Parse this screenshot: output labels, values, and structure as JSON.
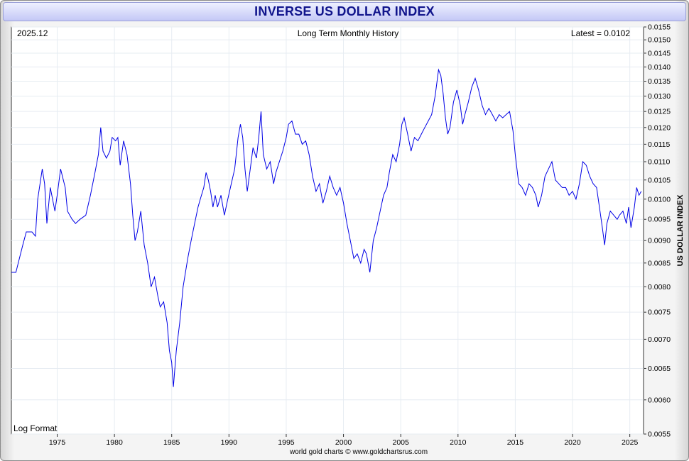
{
  "title": "INVERSE US DOLLAR INDEX",
  "footer": "world gold charts © www.goldchartsrus.com",
  "chart_data": {
    "type": "line",
    "title": "INVERSE US DOLLAR INDEX",
    "subtitle": "Long Term Monthly History",
    "date_label": "2025.12",
    "latest_label": "Latest = 0.0102",
    "scale_note": "Log Format",
    "ylabel": "US DOLLAR INDEX",
    "xlabel": "",
    "y_scale": "log",
    "ylim": [
      0.0055,
      0.0155
    ],
    "xlim": [
      1971.0,
      2026.2
    ],
    "grid": true,
    "line_color": "#0000e6",
    "xticks": [
      1975,
      1980,
      1985,
      1990,
      1995,
      2000,
      2005,
      2010,
      2015,
      2020,
      2025
    ],
    "yticks": [
      "0.0055",
      "0.0060",
      "0.0065",
      "0.0070",
      "0.0075",
      "0.0080",
      "0.0085",
      "0.0090",
      "0.0095",
      "0.0100",
      "0.0105",
      "0.0110",
      "0.0115",
      "0.0120",
      "0.0125",
      "0.0130",
      "0.0135",
      "0.0140",
      "0.0145",
      "0.0150",
      "0.0155"
    ],
    "series": [
      {
        "points": [
          [
            1971.0,
            0.0083
          ],
          [
            1971.4,
            0.0083
          ],
          [
            1971.7,
            0.0086
          ],
          [
            1972.0,
            0.0089
          ],
          [
            1972.3,
            0.0092
          ],
          [
            1972.8,
            0.0092
          ],
          [
            1973.1,
            0.0091
          ],
          [
            1973.3,
            0.01
          ],
          [
            1973.7,
            0.0108
          ],
          [
            1973.9,
            0.0104
          ],
          [
            1974.1,
            0.0094
          ],
          [
            1974.4,
            0.0103
          ],
          [
            1974.8,
            0.0097
          ],
          [
            1975.0,
            0.0101
          ],
          [
            1975.3,
            0.0108
          ],
          [
            1975.7,
            0.0103
          ],
          [
            1975.9,
            0.0097
          ],
          [
            1976.3,
            0.0095
          ],
          [
            1976.6,
            0.0094
          ],
          [
            1977.0,
            0.0095
          ],
          [
            1977.5,
            0.0096
          ],
          [
            1977.9,
            0.0101
          ],
          [
            1978.3,
            0.0107
          ],
          [
            1978.6,
            0.0112
          ],
          [
            1978.8,
            0.012
          ],
          [
            1979.0,
            0.0113
          ],
          [
            1979.3,
            0.0111
          ],
          [
            1979.6,
            0.0113
          ],
          [
            1979.8,
            0.0117
          ],
          [
            1980.1,
            0.0116
          ],
          [
            1980.3,
            0.0117
          ],
          [
            1980.5,
            0.0109
          ],
          [
            1980.8,
            0.0116
          ],
          [
            1981.1,
            0.0112
          ],
          [
            1981.4,
            0.0104
          ],
          [
            1981.6,
            0.0096
          ],
          [
            1981.8,
            0.009
          ],
          [
            1982.0,
            0.0092
          ],
          [
            1982.3,
            0.0097
          ],
          [
            1982.6,
            0.0089
          ],
          [
            1982.9,
            0.0085
          ],
          [
            1983.2,
            0.008
          ],
          [
            1983.5,
            0.0082
          ],
          [
            1983.8,
            0.0078
          ],
          [
            1984.0,
            0.0076
          ],
          [
            1984.3,
            0.0077
          ],
          [
            1984.6,
            0.0073
          ],
          [
            1984.8,
            0.0068
          ],
          [
            1985.0,
            0.0066
          ],
          [
            1985.15,
            0.0062
          ],
          [
            1985.4,
            0.0068
          ],
          [
            1985.7,
            0.0073
          ],
          [
            1986.0,
            0.008
          ],
          [
            1986.4,
            0.0086
          ],
          [
            1986.7,
            0.009
          ],
          [
            1987.0,
            0.0094
          ],
          [
            1987.3,
            0.0098
          ],
          [
            1987.5,
            0.01
          ],
          [
            1987.8,
            0.0103
          ],
          [
            1988.0,
            0.0107
          ],
          [
            1988.2,
            0.0105
          ],
          [
            1988.4,
            0.0102
          ],
          [
            1988.6,
            0.0098
          ],
          [
            1988.8,
            0.0101
          ],
          [
            1989.0,
            0.0098
          ],
          [
            1989.3,
            0.0101
          ],
          [
            1989.6,
            0.0096
          ],
          [
            1989.9,
            0.01
          ],
          [
            1990.2,
            0.0104
          ],
          [
            1990.5,
            0.0108
          ],
          [
            1990.8,
            0.0117
          ],
          [
            1991.0,
            0.0121
          ],
          [
            1991.2,
            0.0117
          ],
          [
            1991.4,
            0.0108
          ],
          [
            1991.6,
            0.0102
          ],
          [
            1991.9,
            0.0109
          ],
          [
            1992.1,
            0.0114
          ],
          [
            1992.4,
            0.0111
          ],
          [
            1992.6,
            0.0117
          ],
          [
            1992.8,
            0.0125
          ],
          [
            1993.0,
            0.0112
          ],
          [
            1993.3,
            0.0108
          ],
          [
            1993.6,
            0.011
          ],
          [
            1993.9,
            0.0104
          ],
          [
            1994.1,
            0.0107
          ],
          [
            1994.4,
            0.011
          ],
          [
            1994.7,
            0.0113
          ],
          [
            1995.0,
            0.0117
          ],
          [
            1995.2,
            0.0121
          ],
          [
            1995.5,
            0.0122
          ],
          [
            1995.8,
            0.0118
          ],
          [
            1996.1,
            0.0118
          ],
          [
            1996.4,
            0.0115
          ],
          [
            1996.7,
            0.0116
          ],
          [
            1997.0,
            0.0112
          ],
          [
            1997.3,
            0.0106
          ],
          [
            1997.6,
            0.0102
          ],
          [
            1997.9,
            0.0104
          ],
          [
            1998.2,
            0.0099
          ],
          [
            1998.5,
            0.0102
          ],
          [
            1998.8,
            0.0106
          ],
          [
            1999.1,
            0.0103
          ],
          [
            1999.4,
            0.0101
          ],
          [
            1999.7,
            0.0103
          ],
          [
            2000.0,
            0.0099
          ],
          [
            2000.3,
            0.0094
          ],
          [
            2000.6,
            0.009
          ],
          [
            2000.9,
            0.0086
          ],
          [
            2001.2,
            0.0087
          ],
          [
            2001.5,
            0.0085
          ],
          [
            2001.8,
            0.0088
          ],
          [
            2002.0,
            0.0087
          ],
          [
            2002.3,
            0.0083
          ],
          [
            2002.6,
            0.009
          ],
          [
            2002.9,
            0.0093
          ],
          [
            2003.2,
            0.0097
          ],
          [
            2003.5,
            0.0101
          ],
          [
            2003.8,
            0.0103
          ],
          [
            2004.0,
            0.0107
          ],
          [
            2004.3,
            0.0112
          ],
          [
            2004.6,
            0.011
          ],
          [
            2004.9,
            0.0115
          ],
          [
            2005.1,
            0.0121
          ],
          [
            2005.3,
            0.0123
          ],
          [
            2005.6,
            0.0118
          ],
          [
            2005.9,
            0.0113
          ],
          [
            2006.2,
            0.0117
          ],
          [
            2006.5,
            0.0116
          ],
          [
            2006.8,
            0.0118
          ],
          [
            2007.1,
            0.012
          ],
          [
            2007.4,
            0.0122
          ],
          [
            2007.7,
            0.0124
          ],
          [
            2008.0,
            0.013
          ],
          [
            2008.3,
            0.0139
          ],
          [
            2008.5,
            0.0137
          ],
          [
            2008.7,
            0.0131
          ],
          [
            2008.9,
            0.0123
          ],
          [
            2009.1,
            0.0118
          ],
          [
            2009.3,
            0.012
          ],
          [
            2009.6,
            0.0128
          ],
          [
            2009.9,
            0.0132
          ],
          [
            2010.2,
            0.0127
          ],
          [
            2010.4,
            0.0121
          ],
          [
            2010.6,
            0.0124
          ],
          [
            2010.9,
            0.0128
          ],
          [
            2011.2,
            0.0133
          ],
          [
            2011.5,
            0.0136
          ],
          [
            2011.8,
            0.0132
          ],
          [
            2012.1,
            0.0127
          ],
          [
            2012.4,
            0.0124
          ],
          [
            2012.7,
            0.0126
          ],
          [
            2013.0,
            0.0124
          ],
          [
            2013.3,
            0.0122
          ],
          [
            2013.6,
            0.0124
          ],
          [
            2013.9,
            0.0123
          ],
          [
            2014.2,
            0.0124
          ],
          [
            2014.5,
            0.0125
          ],
          [
            2014.8,
            0.0119
          ],
          [
            2015.0,
            0.0112
          ],
          [
            2015.3,
            0.0104
          ],
          [
            2015.6,
            0.0103
          ],
          [
            2015.9,
            0.0101
          ],
          [
            2016.2,
            0.0104
          ],
          [
            2016.5,
            0.0103
          ],
          [
            2016.8,
            0.0101
          ],
          [
            2017.0,
            0.0098
          ],
          [
            2017.3,
            0.0101
          ],
          [
            2017.6,
            0.0106
          ],
          [
            2017.9,
            0.0108
          ],
          [
            2018.2,
            0.011
          ],
          [
            2018.5,
            0.0105
          ],
          [
            2018.8,
            0.0104
          ],
          [
            2019.1,
            0.0103
          ],
          [
            2019.4,
            0.0103
          ],
          [
            2019.7,
            0.0101
          ],
          [
            2020.0,
            0.0102
          ],
          [
            2020.3,
            0.01
          ],
          [
            2020.6,
            0.0104
          ],
          [
            2020.9,
            0.011
          ],
          [
            2021.2,
            0.0109
          ],
          [
            2021.5,
            0.0106
          ],
          [
            2021.8,
            0.0104
          ],
          [
            2022.1,
            0.0103
          ],
          [
            2022.4,
            0.0097
          ],
          [
            2022.6,
            0.0093
          ],
          [
            2022.8,
            0.0089
          ],
          [
            2023.0,
            0.0094
          ],
          [
            2023.3,
            0.0097
          ],
          [
            2023.6,
            0.0096
          ],
          [
            2023.9,
            0.0095
          ],
          [
            2024.1,
            0.0096
          ],
          [
            2024.4,
            0.0097
          ],
          [
            2024.7,
            0.0094
          ],
          [
            2024.9,
            0.0098
          ],
          [
            2025.1,
            0.0093
          ],
          [
            2025.4,
            0.0098
          ],
          [
            2025.6,
            0.0103
          ],
          [
            2025.8,
            0.0101
          ],
          [
            2026.0,
            0.0102
          ]
        ]
      }
    ]
  }
}
